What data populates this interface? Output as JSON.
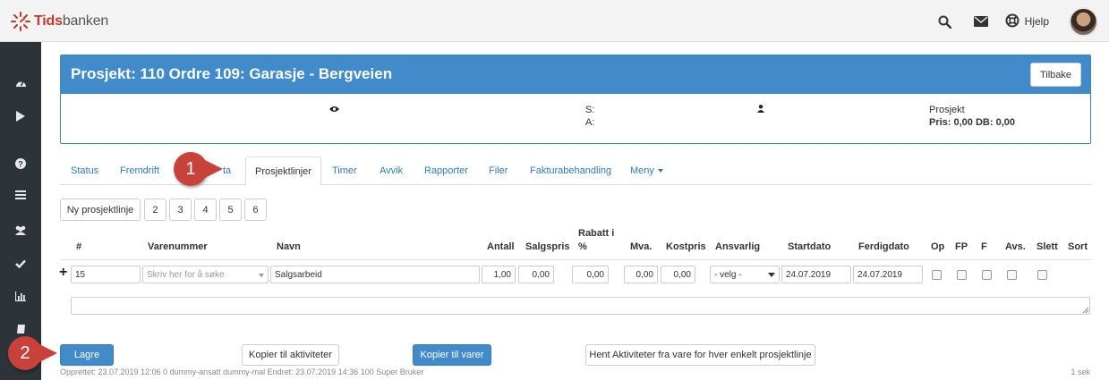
{
  "topbar": {
    "logo_text_red": "Tids",
    "logo_text_grey": "banken",
    "help_label": "Hjelp",
    "icons": [
      "search-icon",
      "envelope-icon",
      "lifebuoy-icon"
    ]
  },
  "sidebar": {
    "icons": [
      "dashboard-icon",
      "play-icon",
      "question-icon",
      "list-icon",
      "users-icon",
      "check-icon",
      "bar-chart-icon",
      "book-icon"
    ]
  },
  "project": {
    "title": "Prosjekt: 110 Ordre 109: Garasje - Bergveien",
    "back_label": "Tilbake",
    "s_label": "S:",
    "a_label": "A:",
    "type": "Prosjekt",
    "price_line": "Pris: 0,00 DB: 0,00"
  },
  "tabs": [
    {
      "label": "Status"
    },
    {
      "label": "Fremdrift"
    },
    {
      "label": "ta"
    },
    {
      "label": "Prosjektlinjer"
    },
    {
      "label": "Timer"
    },
    {
      "label": "Avvik"
    },
    {
      "label": "Rapporter"
    },
    {
      "label": "Filer"
    },
    {
      "label": "Fakturabehandling"
    },
    {
      "label": "Meny"
    }
  ],
  "page_buttons": {
    "new_line": "Ny prosjektlinje",
    "pages": [
      "2",
      "3",
      "4",
      "5",
      "6"
    ]
  },
  "table": {
    "headers": {
      "num": "#",
      "varenummer": "Varenummer",
      "navn": "Navn",
      "antall": "Antall",
      "salgspris": "Salgspris",
      "rabatt1": "Rabatt i",
      "rabatt2": "%",
      "mva": "Mva.",
      "kostpris": "Kostpris",
      "ansvarlig": "Ansvarlig",
      "startdato": "Startdato",
      "ferdigdato": "Ferdigdato",
      "op": "Op",
      "fp": "FP",
      "f": "F",
      "avs": "Avs.",
      "slett": "Slett",
      "sort": "Sort"
    },
    "row": {
      "num": "15",
      "varenummer_placeholder": "Skriv her for å søke",
      "navn": "Salgsarbeid",
      "antall": "1,00",
      "salgspris": "0,00",
      "rabatt": "0,00",
      "mva": "0,00",
      "kostpris": "0,00",
      "ansvarlig": "- velg -",
      "startdato": "24.07.2019",
      "ferdigdato": "24.07.2019"
    }
  },
  "actions": {
    "save": "Lagre",
    "copy_activities": "Kopier til aktiviteter",
    "copy_items": "Kopier til varer",
    "fetch_activities": "Hent Aktiviteter fra vare for hver enkelt prosjektlinje"
  },
  "footer": {
    "meta": "Opprettet: 23.07.2019 12:06 0 dummy-ansatt dummy-mal Endret: 23.07.2019 14:36 100 Super Bruker",
    "timing": "1 sek"
  },
  "callouts": {
    "one": "1",
    "two": "2"
  }
}
